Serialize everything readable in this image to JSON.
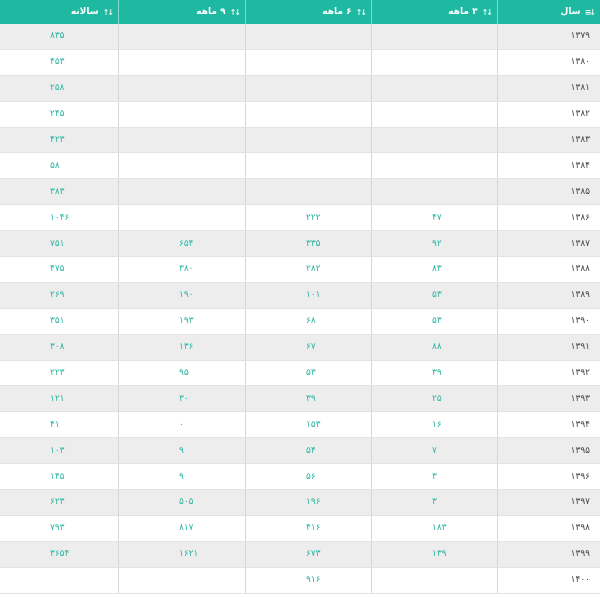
{
  "headers": {
    "year": "سال",
    "m3": "۳ ماهه",
    "m6": "۶ ماهه",
    "m9": "۹ ماهه",
    "annual": "سالانه"
  },
  "rows": [
    {
      "year": "۱۳۷۹",
      "m3": "",
      "m6": "",
      "m9": "",
      "annual": "۸۳۵"
    },
    {
      "year": "۱۳۸۰",
      "m3": "",
      "m6": "",
      "m9": "",
      "annual": "۴۵۳"
    },
    {
      "year": "۱۳۸۱",
      "m3": "",
      "m6": "",
      "m9": "",
      "annual": "۲۵۸"
    },
    {
      "year": "۱۳۸۲",
      "m3": "",
      "m6": "",
      "m9": "",
      "annual": "۲۴۵"
    },
    {
      "year": "۱۳۸۳",
      "m3": "",
      "m6": "",
      "m9": "",
      "annual": "۴۲۳"
    },
    {
      "year": "۱۳۸۴",
      "m3": "",
      "m6": "",
      "m9": "",
      "annual": "۵۸"
    },
    {
      "year": "۱۳۸۵",
      "m3": "",
      "m6": "",
      "m9": "",
      "annual": "۳۸۳"
    },
    {
      "year": "۱۳۸۶",
      "m3": "۴۷",
      "m6": "۲۲۲",
      "m9": "",
      "annual": "۱۰۴۶"
    },
    {
      "year": "۱۳۸۷",
      "m3": "۹۲",
      "m6": "۳۳۵",
      "m9": "۶۵۴",
      "annual": "۷۵۱"
    },
    {
      "year": "۱۳۸۸",
      "m3": "۸۳",
      "m6": "۲۸۲",
      "m9": "۳۸۰",
      "annual": "۴۷۵"
    },
    {
      "year": "۱۳۸۹",
      "m3": "۵۳",
      "m6": "۱۰۱",
      "m9": "۱۹۰",
      "annual": "۲۶۹"
    },
    {
      "year": "۱۳۹۰",
      "m3": "۵۳",
      "m6": "۶۸",
      "m9": "۱۹۳",
      "annual": "۳۵۱"
    },
    {
      "year": "۱۳۹۱",
      "m3": "۸۸",
      "m6": "۶۷",
      "m9": "۱۳۶",
      "annual": "۳۰۸"
    },
    {
      "year": "۱۳۹۲",
      "m3": "۳۹",
      "m6": "۵۳",
      "m9": "۹۵",
      "annual": "۲۲۳"
    },
    {
      "year": "۱۳۹۳",
      "m3": "۲۵",
      "m6": "۳۹",
      "m9": "۳۰",
      "annual": "۱۲۱"
    },
    {
      "year": "۱۳۹۴",
      "m3": "۱۶",
      "m6": "۱۵۳",
      "m9": "۰",
      "annual": "۴۱"
    },
    {
      "year": "۱۳۹۵",
      "m3": "۷",
      "m6": "۵۴",
      "m9": "۹",
      "annual": "۱۰۳"
    },
    {
      "year": "۱۳۹۶",
      "m3": "۳",
      "m6": "۵۶",
      "m9": "۹",
      "annual": "۱۴۵"
    },
    {
      "year": "۱۳۹۷",
      "m3": "۳",
      "m6": "۱۹۶",
      "m9": "۵۰۵",
      "annual": "۶۲۳"
    },
    {
      "year": "۱۳۹۸",
      "m3": "۱۸۳",
      "m6": "۴۱۶",
      "m9": "۸۱۷",
      "annual": "۷۹۳"
    },
    {
      "year": "۱۳۹۹",
      "m3": "۱۳۹",
      "m6": "۶۷۳",
      "m9": "۱۶۲۱",
      "annual": "۳۶۵۴"
    },
    {
      "year": "۱۴۰۰",
      "m3": "",
      "m6": "۹۱۶",
      "m9": "",
      "annual": ""
    }
  ],
  "icons": {
    "year_sort": "sort-asc-icon",
    "column_sort": "sort-both-icon"
  },
  "colors": {
    "header": "#1fb8a0",
    "value_text": "#2bb4a0",
    "stripe": "#ededed"
  }
}
